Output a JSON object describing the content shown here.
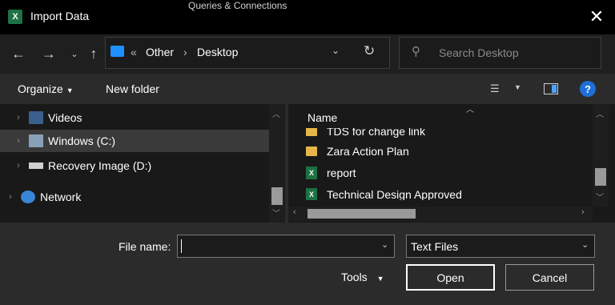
{
  "window": {
    "title": "Import Data",
    "app_icon_letter": "X",
    "background_text": "Queries & Connections"
  },
  "nav": {
    "breadcrumb_prefix": "«",
    "breadcrumbs": [
      "Other",
      "Desktop"
    ],
    "search_placeholder": "Search Desktop"
  },
  "toolbar": {
    "organize": "Organize",
    "new_folder": "New folder",
    "help": "?"
  },
  "nav_pane": {
    "items": [
      {
        "label": "Videos",
        "icon": "videos-icon"
      },
      {
        "label": "Windows (C:)",
        "icon": "drive-icon",
        "selected": true
      },
      {
        "label": "Recovery Image (D:)",
        "icon": "drive-icon"
      },
      {
        "label": "Network",
        "icon": "network-icon"
      }
    ]
  },
  "files": {
    "column_name": "Name",
    "rows": [
      {
        "name": "TDS for change link",
        "type": "folder"
      },
      {
        "name": "Zara Action Plan",
        "type": "folder"
      },
      {
        "name": "report",
        "type": "excel"
      },
      {
        "name": "Technical Design Approved",
        "type": "excel"
      }
    ]
  },
  "footer": {
    "file_name_label": "File name:",
    "file_name_value": "",
    "filter_value": "Text Files",
    "tools_label": "Tools",
    "open_label": "Open",
    "cancel_label": "Cancel"
  },
  "colors": {
    "accent": "#1e6fd9",
    "excel_green": "#1e7145",
    "folder": "#e6b64a"
  }
}
